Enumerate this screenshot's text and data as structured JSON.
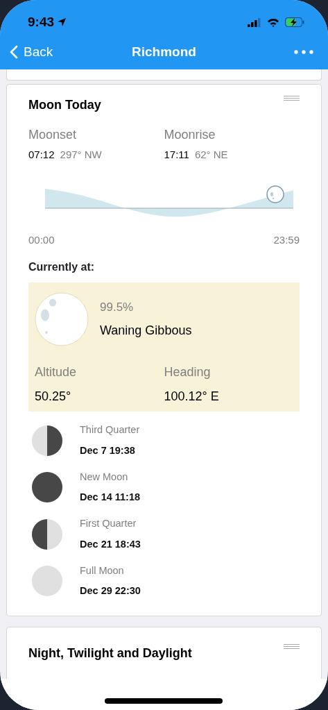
{
  "status_bar": {
    "time": "9:43"
  },
  "nav": {
    "back": "Back",
    "title": "Richmond"
  },
  "moon_card": {
    "title": "Moon Today",
    "events": [
      {
        "label": "Moonset",
        "time": "07:12",
        "direction": "297° NW"
      },
      {
        "label": "Moonrise",
        "time": "17:11",
        "direction": "62° NE"
      }
    ],
    "chart": {
      "start": "00:00",
      "end": "23:59"
    },
    "current": {
      "heading": "Currently at:",
      "illumination": "99.5%",
      "phase": "Waning Gibbous",
      "stats": [
        {
          "label": "Altitude",
          "value": "50.25°"
        },
        {
          "label": "Heading",
          "value": "100.12° E"
        }
      ]
    },
    "phases": [
      {
        "kind": "third_quarter",
        "name": "Third Quarter",
        "date": "Dec 7 19:38"
      },
      {
        "kind": "new",
        "name": "New Moon",
        "date": "Dec 14 11:18"
      },
      {
        "kind": "first_quarter",
        "name": "First Quarter",
        "date": "Dec 21 18:43"
      },
      {
        "kind": "full",
        "name": "Full Moon",
        "date": "Dec 29 22:30"
      }
    ]
  },
  "next_card": {
    "title": "Night, Twilight and Daylight"
  }
}
